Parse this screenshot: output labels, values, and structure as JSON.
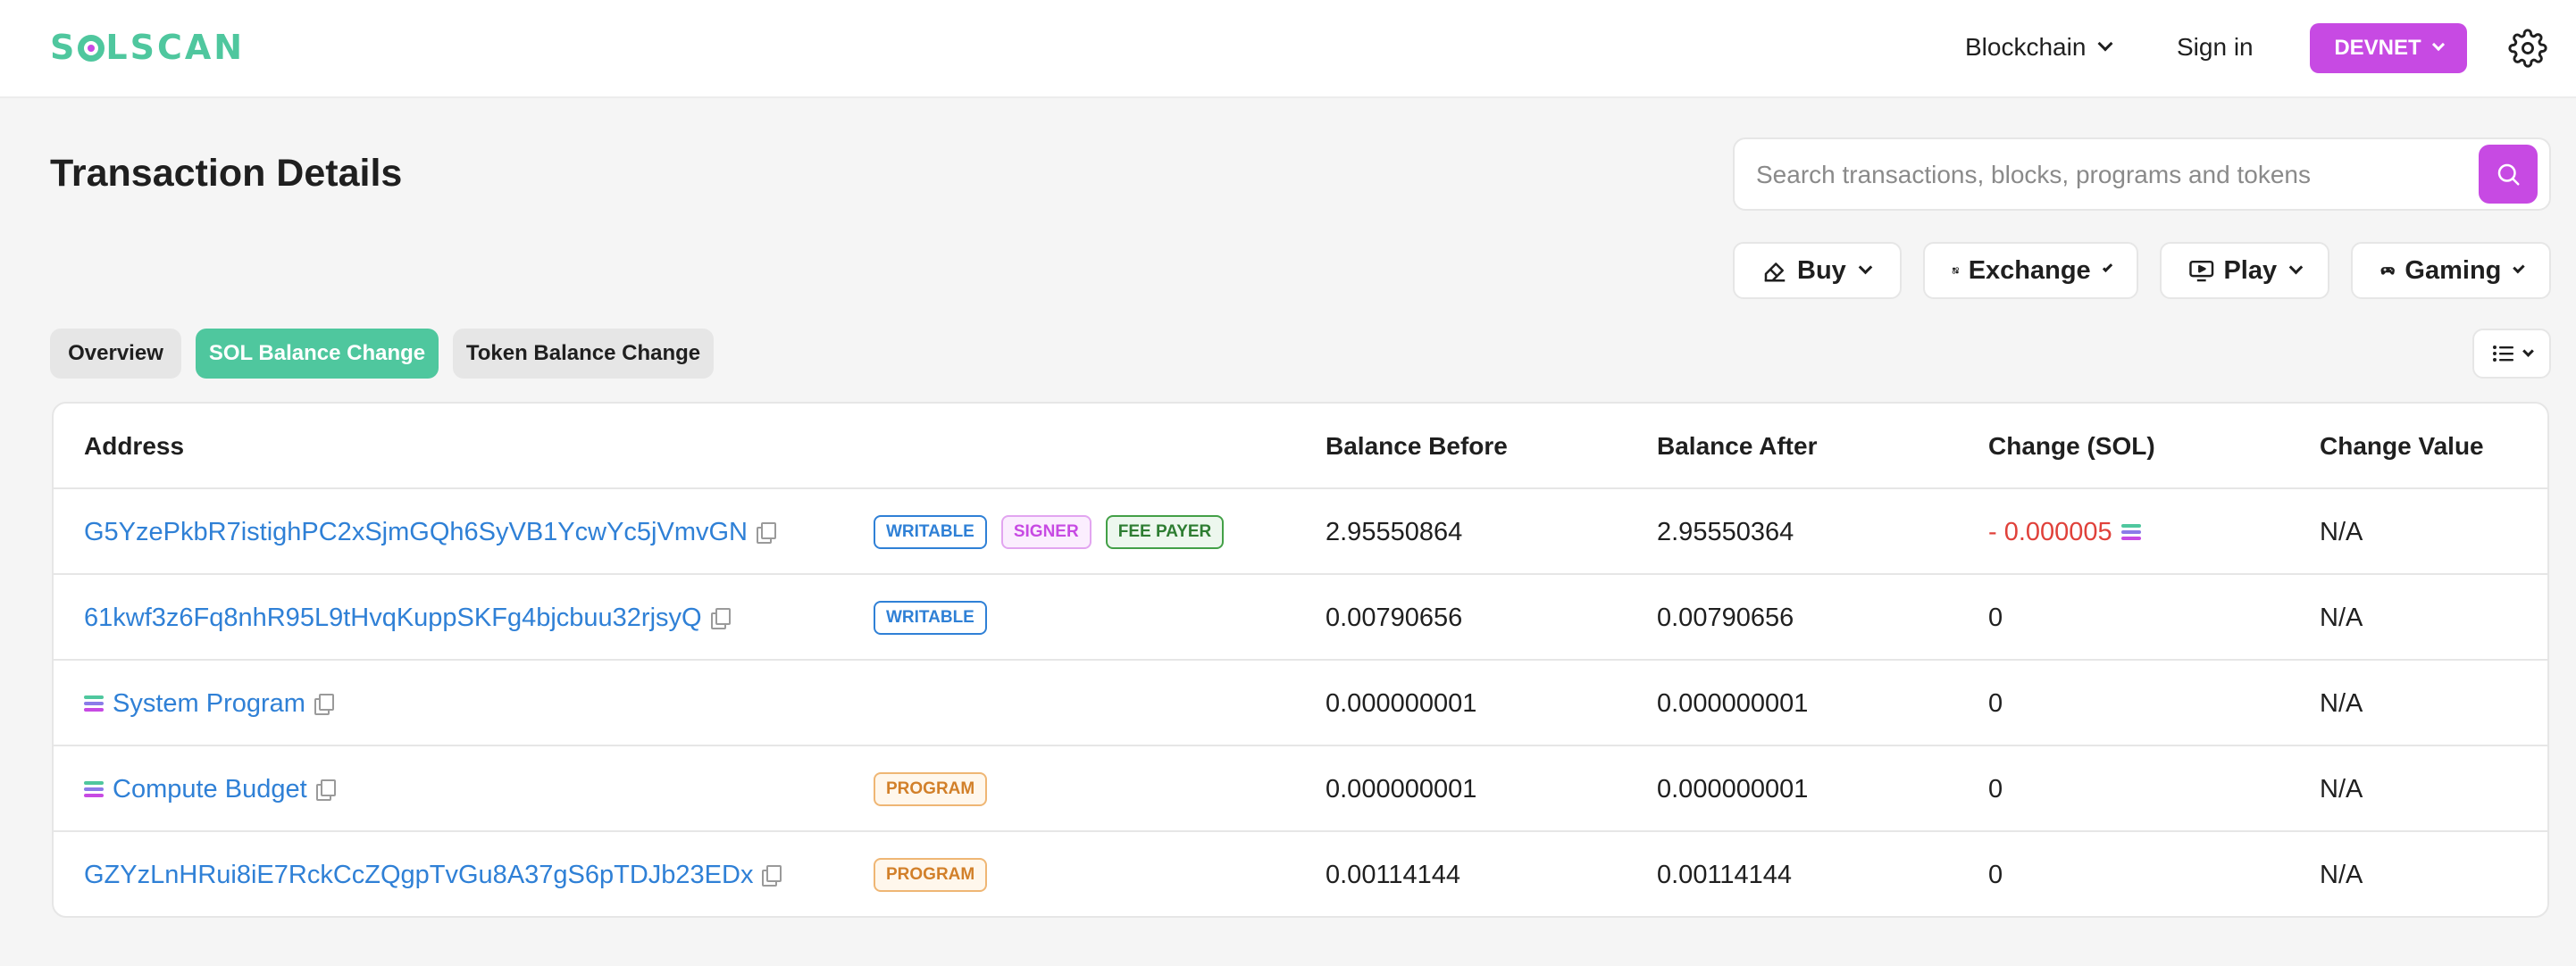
{
  "brand": {
    "logo_pre": "S",
    "logo_post": "LSCAN",
    "accent": "#c74ae3",
    "green": "#4fc79e"
  },
  "nav": {
    "blockchain": "Blockchain",
    "signin": "Sign in",
    "network": "DEVNET"
  },
  "page": {
    "title": "Transaction Details"
  },
  "search": {
    "placeholder": "Search transactions, blocks, programs and tokens"
  },
  "menus": {
    "buy": "Buy",
    "exchange": "Exchange",
    "play": "Play",
    "gaming": "Gaming"
  },
  "tabs": {
    "overview": "Overview",
    "sol_balance": "SOL Balance Change",
    "token_balance": "Token Balance Change"
  },
  "table": {
    "headers": {
      "address": "Address",
      "balance_before": "Balance Before",
      "balance_after": "Balance After",
      "change": "Change (SOL)",
      "change_value": "Change Value"
    },
    "rows": [
      {
        "address": "G5YzePkbR7istighPC2xSjmGQh6SyVB1YcwYc5jVmvGN",
        "badges": [
          "WRITABLE",
          "SIGNER",
          "FEE PAYER"
        ],
        "before": "2.95550864",
        "after": "2.95550364",
        "change": "- 0.000005",
        "value": "N/A"
      },
      {
        "address": "61kwf3z6Fq8nhR95L9tHvqKuppSKFg4bjcbuu32rjsyQ",
        "badges": [
          "WRITABLE"
        ],
        "before": "0.00790656",
        "after": "0.00790656",
        "change": "0",
        "value": "N/A"
      },
      {
        "address": "System Program",
        "badges": [],
        "before": "0.000000001",
        "after": "0.000000001",
        "change": "0",
        "value": "N/A"
      },
      {
        "address": "Compute Budget",
        "badges": [
          "PROGRAM"
        ],
        "before": "0.000000001",
        "after": "0.000000001",
        "change": "0",
        "value": "N/A"
      },
      {
        "address": "GZYzLnHRui8iE7RckCcZQgpTvGu8A37gS6pTDJb23EDx",
        "badges": [
          "PROGRAM"
        ],
        "before": "0.00114144",
        "after": "0.00114144",
        "change": "0",
        "value": "N/A"
      }
    ]
  }
}
